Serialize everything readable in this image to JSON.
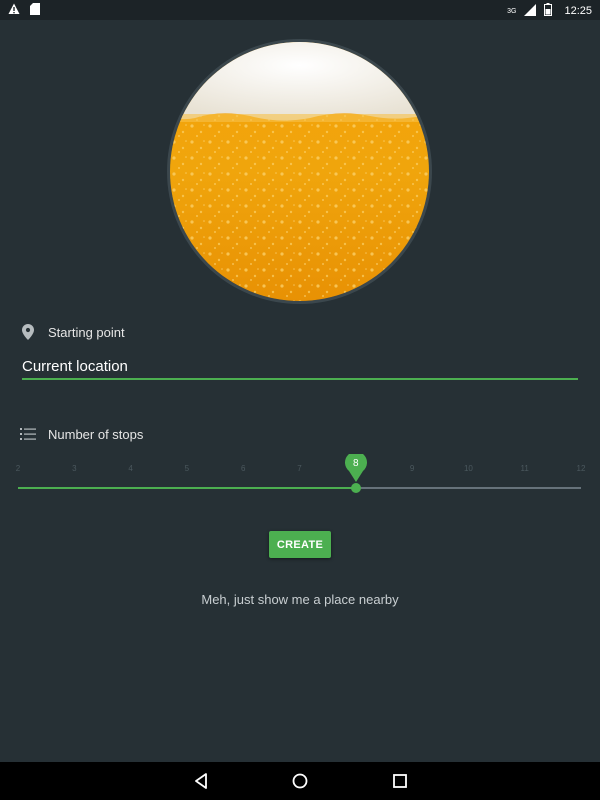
{
  "status_bar": {
    "time": "12:25",
    "network": "3G",
    "left_icons": [
      "warning-icon",
      "sd-card-icon"
    ],
    "right_icons": [
      "signal-icon",
      "battery-icon"
    ]
  },
  "hero": {
    "image": "beer-glass-icon"
  },
  "starting_point": {
    "label": "Starting point",
    "icon": "location-pin-icon",
    "value": "Current location"
  },
  "stops": {
    "label": "Number of stops",
    "icon": "list-icon",
    "min": 2,
    "max": 12,
    "ticks": [
      "2",
      "3",
      "4",
      "5",
      "6",
      "7",
      "8",
      "9",
      "10",
      "11",
      "12"
    ],
    "value": 8,
    "value_label": "8"
  },
  "actions": {
    "create_label": "CREATE",
    "nearby_label": "Meh, just show me a place nearby"
  },
  "nav_bar": {
    "back": "back-icon",
    "home": "home-icon",
    "recents": "recents-icon"
  },
  "colors": {
    "background": "#263035",
    "accent": "#4caf50",
    "status_bar": "#1c2327",
    "nav_bar": "#000000"
  }
}
